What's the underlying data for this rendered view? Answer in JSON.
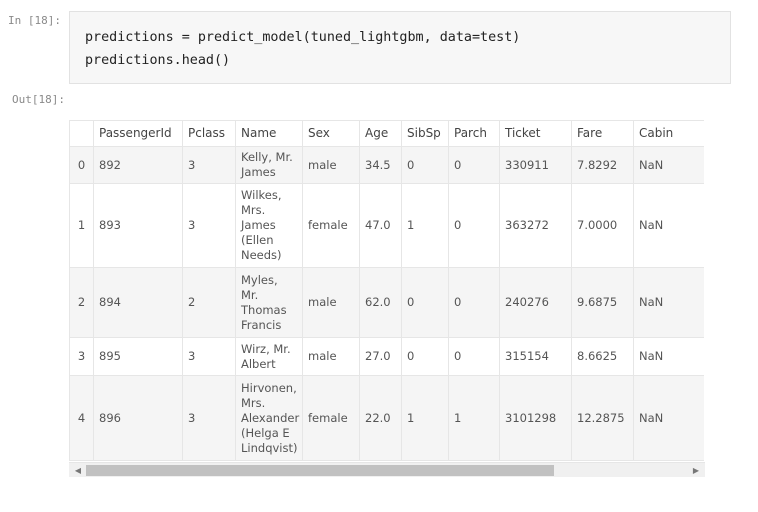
{
  "cells": {
    "in_prompt": "In [18]:",
    "out_prompt": "Out[18]:",
    "code_lines": [
      "predictions = predict_model(tuned_lightgbm, data=test)",
      "predictions.head()"
    ]
  },
  "table": {
    "columns": [
      "",
      "PassengerId",
      "Pclass",
      "Name",
      "Sex",
      "Age",
      "SibSp",
      "Parch",
      "Ticket",
      "Fare",
      "Cabin"
    ],
    "rows": [
      {
        "index": "0",
        "cells": [
          "892",
          "3",
          "Kelly, Mr. James",
          "male",
          "34.5",
          "0",
          "0",
          "330911",
          "7.8292",
          "NaN"
        ]
      },
      {
        "index": "1",
        "cells": [
          "893",
          "3",
          "Wilkes, Mrs. James (Ellen Needs)",
          "female",
          "47.0",
          "1",
          "0",
          "363272",
          "7.0000",
          "NaN"
        ]
      },
      {
        "index": "2",
        "cells": [
          "894",
          "2",
          "Myles, Mr. Thomas Francis",
          "male",
          "62.0",
          "0",
          "0",
          "240276",
          "9.6875",
          "NaN"
        ]
      },
      {
        "index": "3",
        "cells": [
          "895",
          "3",
          "Wirz, Mr. Albert",
          "male",
          "27.0",
          "0",
          "0",
          "315154",
          "8.6625",
          "NaN"
        ]
      },
      {
        "index": "4",
        "cells": [
          "896",
          "3",
          "Hirvonen, Mrs. Alexander (Helga E Lindqvist)",
          "female",
          "22.0",
          "1",
          "1",
          "3101298",
          "12.2875",
          "NaN"
        ]
      }
    ]
  },
  "scrollbar": {
    "left_arrow": "◀",
    "right_arrow": "▶",
    "thumb_fraction": 0.75
  }
}
